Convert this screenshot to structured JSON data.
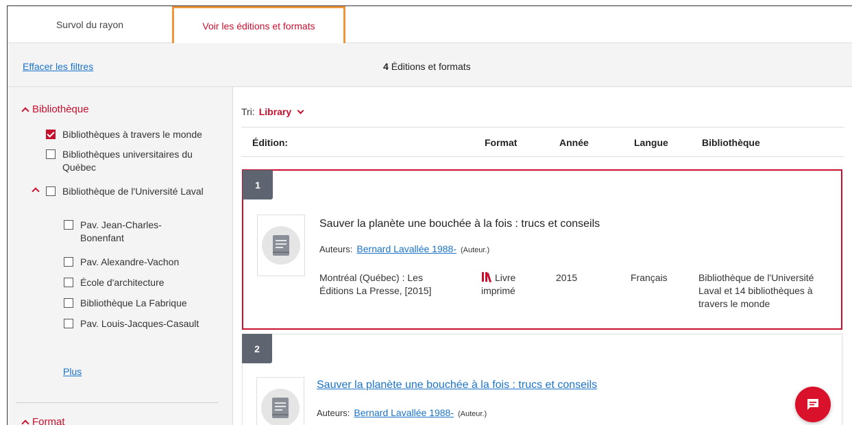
{
  "tabs": {
    "overview": "Survol du rayon",
    "editions": "Voir les éditions et formats"
  },
  "filter_bar": {
    "clear": "Effacer les filtres",
    "count": "4",
    "count_label": "Éditions et formats"
  },
  "sidebar": {
    "library_heading": "Bibliothèque",
    "options": [
      {
        "label": "Bibliothèques à travers le monde",
        "checked": true
      },
      {
        "label": "Bibliothèques universitaires du Québec",
        "checked": false
      },
      {
        "label": "Bibliothèque de l'Université Laval",
        "checked": false
      },
      {
        "label": "Pav. Jean-Charles-Bonenfant",
        "checked": false
      },
      {
        "label": "Pav. Alexandre-Vachon",
        "checked": false
      },
      {
        "label": "École d'architecture",
        "checked": false
      },
      {
        "label": "Bibliothèque La Fabrique",
        "checked": false
      },
      {
        "label": "Pav. Louis-Jacques-Casault",
        "checked": false
      }
    ],
    "more": "Plus",
    "format_heading": "Format"
  },
  "main": {
    "sort_label": "Tri:",
    "sort_value": "Library",
    "columns": {
      "edition": "Édition:",
      "format": "Format",
      "year": "Année",
      "language": "Langue",
      "library": "Bibliothèque"
    },
    "results": [
      {
        "number": "1",
        "title": "Sauver la planète une bouchée à la fois : trucs et conseils",
        "authors_label": "Auteurs:",
        "author": "Bernard Lavallée 1988-",
        "author_role": "(Auteur.)",
        "publisher": "Montréal (Québec) : Les Éditions La Presse, [2015]",
        "format": "Livre imprimé",
        "year": "2015",
        "language": "Français",
        "library": "Bibliothèque de l'Université Laval et 14 bibliothèques à travers le monde"
      },
      {
        "number": "2",
        "title": "Sauver la planète une bouchée à la fois : trucs et conseils",
        "authors_label": "Auteurs:",
        "author": "Bernard Lavallée 1988-",
        "author_role": "(Auteur.)"
      }
    ]
  },
  "colors": {
    "accent": "#c8102e",
    "link": "#1a73c9",
    "tab_highlight": "#f0953a",
    "badge": "#5e6470"
  },
  "icons": {
    "chat": "chat-icon",
    "book": "book-icon",
    "format": "library-books-icon"
  }
}
